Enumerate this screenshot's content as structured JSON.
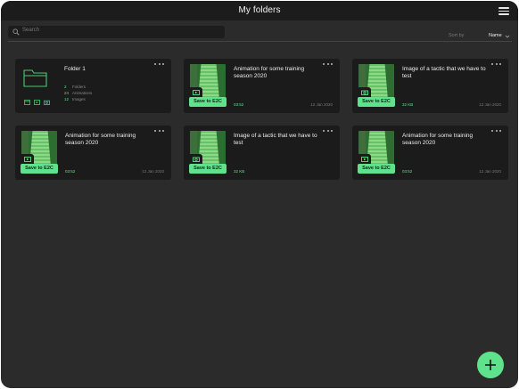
{
  "header": {
    "title": "My folders",
    "menu_icon": "hamburger-menu-icon"
  },
  "search": {
    "placeholder": "Search",
    "icon": "search-icon"
  },
  "sort": {
    "label": "Sort by",
    "value": "Name"
  },
  "folder": {
    "title": "Folder 1",
    "stats": [
      {
        "count": "2",
        "label": "Folders"
      },
      {
        "count": "24",
        "label": "Animations"
      },
      {
        "count": "12",
        "label": "Images"
      }
    ],
    "icons": [
      "folder-mini-icon",
      "video-mini-icon",
      "camera-mini-icon"
    ]
  },
  "cards": [
    {
      "type": "animation",
      "title": "Animation for some training season 2020",
      "meta": "03:52",
      "date": "12 Jan 2020",
      "button": "Save to E2C"
    },
    {
      "type": "image",
      "title": "Image of a tactic that we have to test",
      "meta": "32 KB",
      "date": "12 Jan 2020",
      "button": "Save to E2C"
    },
    {
      "type": "animation",
      "title": "Animation for some training season 2020",
      "meta": "03:52",
      "date": "12 Jan 2020",
      "button": "Save to E2C"
    },
    {
      "type": "image",
      "title": "Image of a tactic that we have to test",
      "meta": "32 KB",
      "date": "",
      "button": "Save to E2C"
    },
    {
      "type": "animation",
      "title": "Animation for some training season 2020",
      "meta": "03:52",
      "date": "12 Jan 2020",
      "button": "Save to E2C"
    }
  ],
  "colors": {
    "accent": "#5ee28b",
    "background": "#2b2b2b",
    "card": "#1b1b1b",
    "topbar": "#1c1c1c"
  },
  "fab": {
    "icon": "plus-icon"
  }
}
